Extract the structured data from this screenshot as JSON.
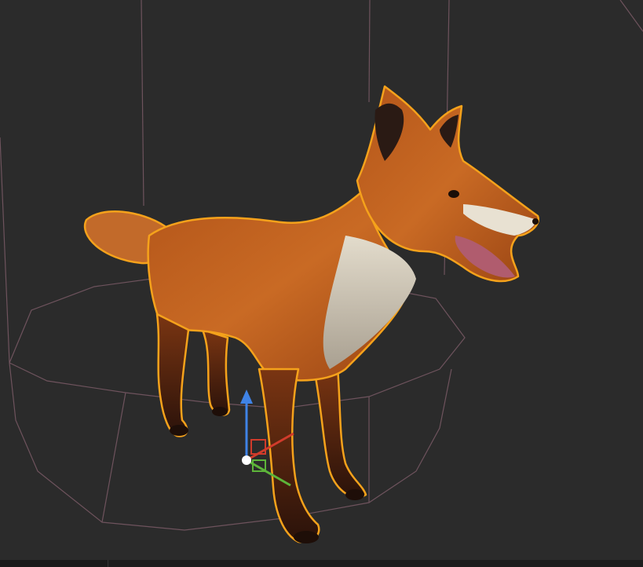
{
  "viewport": {
    "background_color": "#2b2b2b",
    "wireframe_color": "#7a5a66",
    "selection_outline_color": "#f5a21b"
  },
  "object": {
    "name_icon": "fox-model",
    "fur_colors": {
      "orange": "#c2621e",
      "dark_orange": "#8e3f12",
      "cream": "#d9d2c2",
      "dark_leg": "#3a1a10",
      "mouth": "#b05c6e"
    }
  },
  "gizmo": {
    "axes": [
      {
        "axis": "x",
        "color": "#d13b2b"
      },
      {
        "axis": "y",
        "color": "#5db53a"
      },
      {
        "axis": "z",
        "color": "#3f83e6"
      }
    ],
    "pivot_color": "#ffffff"
  }
}
